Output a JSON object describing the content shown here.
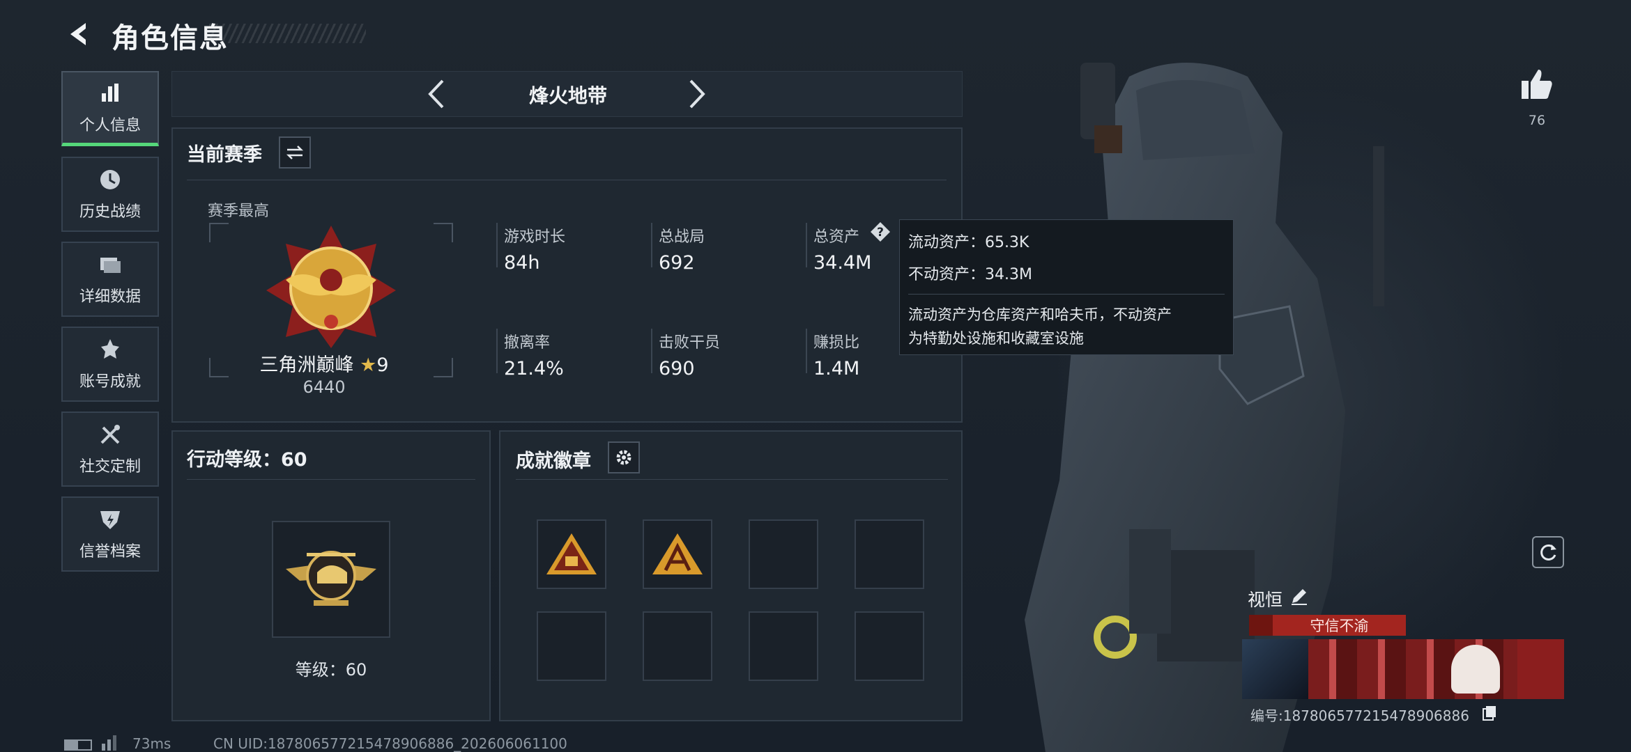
{
  "header": {
    "title": "角色信息"
  },
  "sidebar": {
    "items": [
      {
        "label": "个人信息",
        "icon": "bar-chart-icon"
      },
      {
        "label": "历史战绩",
        "icon": "clock-icon"
      },
      {
        "label": "详细数据",
        "icon": "folder-icon"
      },
      {
        "label": "账号成就",
        "icon": "achievement-icon"
      },
      {
        "label": "社交定制",
        "icon": "tools-icon"
      },
      {
        "label": "信誉档案",
        "icon": "shield-icon"
      }
    ]
  },
  "mode": {
    "name": "烽火地带"
  },
  "season": {
    "title": "当前赛季",
    "best_label": "赛季最高",
    "rank_name": "三角洲巅峰",
    "rank_stars": "9",
    "rank_score": "6440"
  },
  "stats": [
    {
      "label": "游戏时长",
      "value": "84h"
    },
    {
      "label": "总战局",
      "value": "692"
    },
    {
      "label": "总资产",
      "value": "34.4M"
    },
    {
      "label": "撤离率",
      "value": "21.4%"
    },
    {
      "label": "击败干员",
      "value": "690"
    },
    {
      "label": "赚损比",
      "value": "1.4M"
    }
  ],
  "tooltip": {
    "liquid": "流动资产：65.3K",
    "fixed": "不动资产：34.3M",
    "desc_line1": "流动资产为仓库资产和哈夫币，不动资产",
    "desc_line2": "为特勤处设施和收藏室设施"
  },
  "action_level": {
    "title": "行动等级：60",
    "level_text": "等级：60"
  },
  "achievements": {
    "title": "成就徽章"
  },
  "likes": {
    "count": "76"
  },
  "player": {
    "name": "视恒",
    "tag": "守信不渝",
    "id_text": "编号:187806577215478906886"
  },
  "footer": {
    "ping": "73ms",
    "uid": "CN UID:187806577215478906886_202606061100"
  },
  "colors": {
    "accent_green": "#55d77a",
    "tag_red": "#a3251f",
    "rank_gold": "#d9a63a"
  }
}
